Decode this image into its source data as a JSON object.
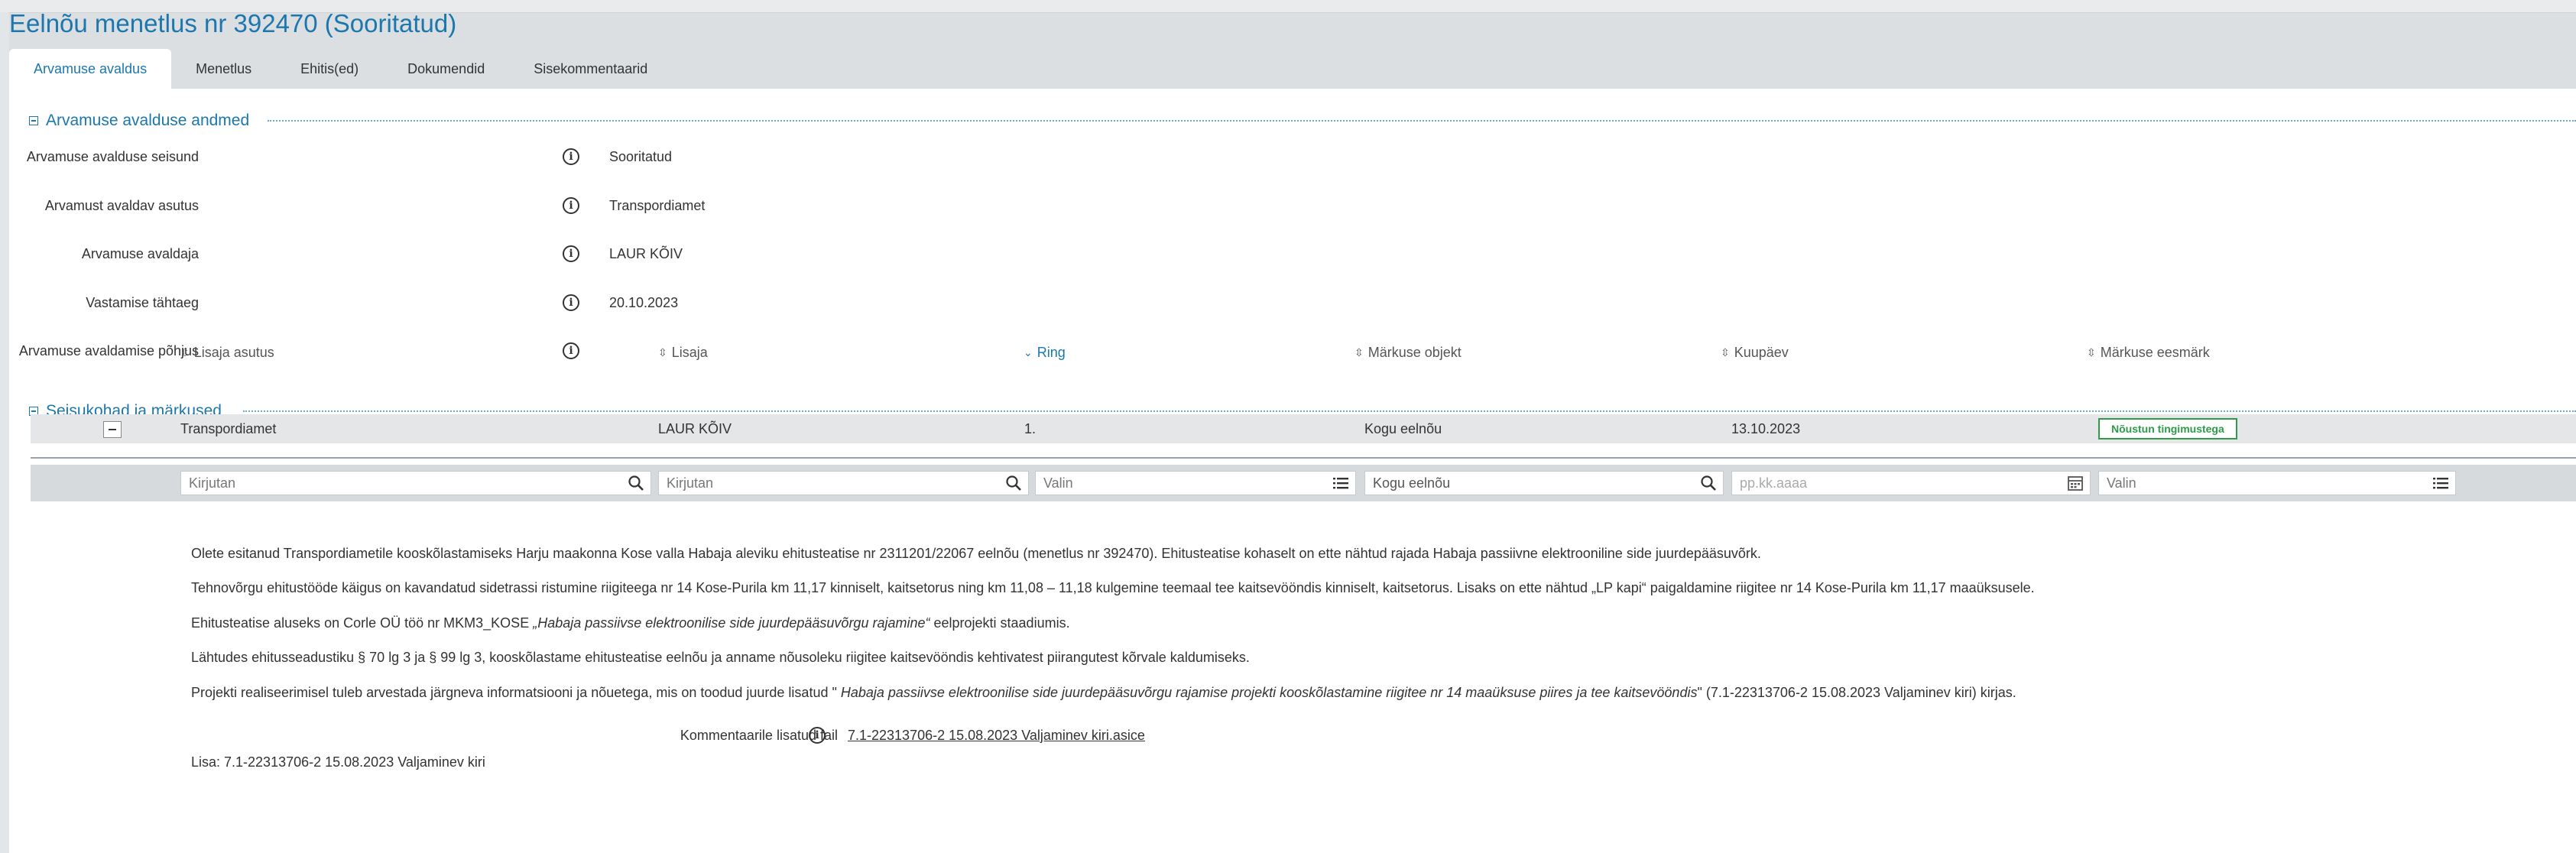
{
  "page": {
    "title": "Eelnõu menetlus nr 392470 (Sooritatud)"
  },
  "tabs": [
    {
      "label": "Arvamuse avaldus",
      "active": true
    },
    {
      "label": "Menetlus"
    },
    {
      "label": "Ehitis(ed)"
    },
    {
      "label": "Dokumendid"
    },
    {
      "label": "Sisekommentaarid"
    }
  ],
  "opinion_section": {
    "title": "Arvamuse avalduse andmed",
    "fields": [
      {
        "label": "Arvamuse avalduse seisund",
        "value": "Sooritatud"
      },
      {
        "label": "Arvamust avaldav asutus",
        "value": "Transpordiamet"
      },
      {
        "label": "Arvamuse avaldaja",
        "value": "LAUR KÕIV"
      },
      {
        "label": "Vastamise tähtaeg",
        "value": "20.10.2023"
      },
      {
        "label": "Arvamuse avaldamise põhjus",
        "value": ""
      }
    ]
  },
  "positions_section": {
    "title": "Seisukohad ja märkused",
    "columns": [
      "Lisaja asutus",
      "Lisaja",
      "Ring",
      "Märkuse objekt",
      "Kuupäev",
      "Märkuse eesmärk"
    ],
    "filters": [
      {
        "placeholder": "Kirjutan",
        "icon": "search-icon"
      },
      {
        "placeholder": "Kirjutan",
        "icon": "search-icon"
      },
      {
        "placeholder": "Valin",
        "icon": "list-icon"
      },
      {
        "value": "Kogu eelnõu",
        "icon": "search-icon"
      },
      {
        "placeholder": "pp.kk.aaaa",
        "icon": "calendar-icon"
      },
      {
        "placeholder": "Valin",
        "icon": "list-icon"
      }
    ],
    "row": {
      "asutus": "Transpordiamet",
      "lisaja": "LAUR KÕIV",
      "ring": "1.",
      "objekt": "Kogu eelnõu",
      "kuupaev": "13.10.2023",
      "eesmark": "Nõustun tingimustega"
    },
    "comment": {
      "p1": "Olete esitanud Transpordiametile kooskõlastamiseks Harju maakonna Kose valla Habaja aleviku ehitusteatise nr 2311201/22067 eelnõu (menetlus nr 392470). Ehitusteatise kohaselt on ette nähtud rajada Habaja passiivne elektrooniline side juurdepääsuvõrk.",
      "p2": "Tehnovõrgu ehitustööde käigus on kavandatud sidetrassi ristumine riigiteega nr 14 Kose-Purila km 11,17 kinniselt, kaitsetorus ning km 11,08 – 11,18 kulgemine teemaal tee kaitsevööndis kinniselt, kaitsetorus. Lisaks on ette nähtud „LP kapi“ paigaldamine riigitee nr 14 Kose-Purila km 11,17 maaüksusele.",
      "p3_a": "Ehitusteatise aluseks on Corle OÜ töö nr MKM3_KOSE ",
      "p3_b": "„Habaja passiivse elektroonilise side juurdepääsuvõrgu rajamine“",
      "p3_c": " eelprojekti staadiumis.",
      "p4": "Lähtudes ehitusseadustiku § 70 lg 3 ja § 99 lg 3, kooskõlastame ehitusteatise eelnõu ja anname nõusoleku riigitee kaitsevööndis kehtivatest piirangutest kõrvale kaldumiseks.",
      "p5_a": "Projekti realiseerimisel tuleb arvestada järgneva informatsiooni ja nõuetega, mis on toodud juurde lisatud \" ",
      "p5_b": "Habaja passiivse elektroonilise side juurdepääsuvõrgu rajamise projekti kooskõlastamine riigitee nr 14 maaüksuse piires ja tee kaitsevööndis",
      "p5_c": "\" (7.1-22313706-2 15.08.2023 Valjaminev kiri) kirjas.",
      "lisa": "Lisa: 7.1-22313706-2 15.08.2023 Valjaminev kiri"
    },
    "attachment": {
      "label": "Kommentaarile lisatud fail",
      "file": "7.1-22313706-2 15.08.2023 Valjaminev kiri.asice"
    }
  },
  "colors": {
    "accent": "#1b77ad",
    "badge": "#2e9a4a",
    "background": "#dcdfe2"
  }
}
